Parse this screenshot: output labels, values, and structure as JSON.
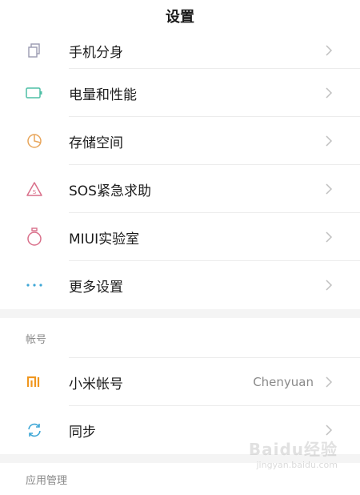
{
  "header": {
    "title": "设置"
  },
  "items": [
    {
      "label": "手机分身",
      "icon": "dual-apps-icon",
      "color": "#9a9ab0"
    },
    {
      "label": "电量和性能",
      "icon": "battery-icon",
      "color": "#4fbfa6"
    },
    {
      "label": "存储空间",
      "icon": "storage-pie-icon",
      "color": "#e8a55a"
    },
    {
      "label": "SOS紧急求助",
      "icon": "sos-warning-icon",
      "color": "#d96f8a"
    },
    {
      "label": "MIUI实验室",
      "icon": "lab-flask-icon",
      "color": "#d96f8a"
    },
    {
      "label": "更多设置",
      "icon": "more-dots-icon",
      "color": "#3fa7d6"
    }
  ],
  "account_section": {
    "title": "帐号",
    "items": [
      {
        "label": "小米帐号",
        "value": "Chenyuan",
        "icon": "mi-logo-icon",
        "color": "#f0961e"
      },
      {
        "label": "同步",
        "icon": "sync-icon",
        "color": "#3fa7d6"
      }
    ]
  },
  "app_section": {
    "title": "应用管理"
  },
  "watermark": {
    "brand": "Baidu经验",
    "url": "jingyan.baidu.com"
  },
  "colors": {
    "background": "#ffffff",
    "section_gap": "#f4f4f4",
    "chevron": "#c0c0c0"
  }
}
